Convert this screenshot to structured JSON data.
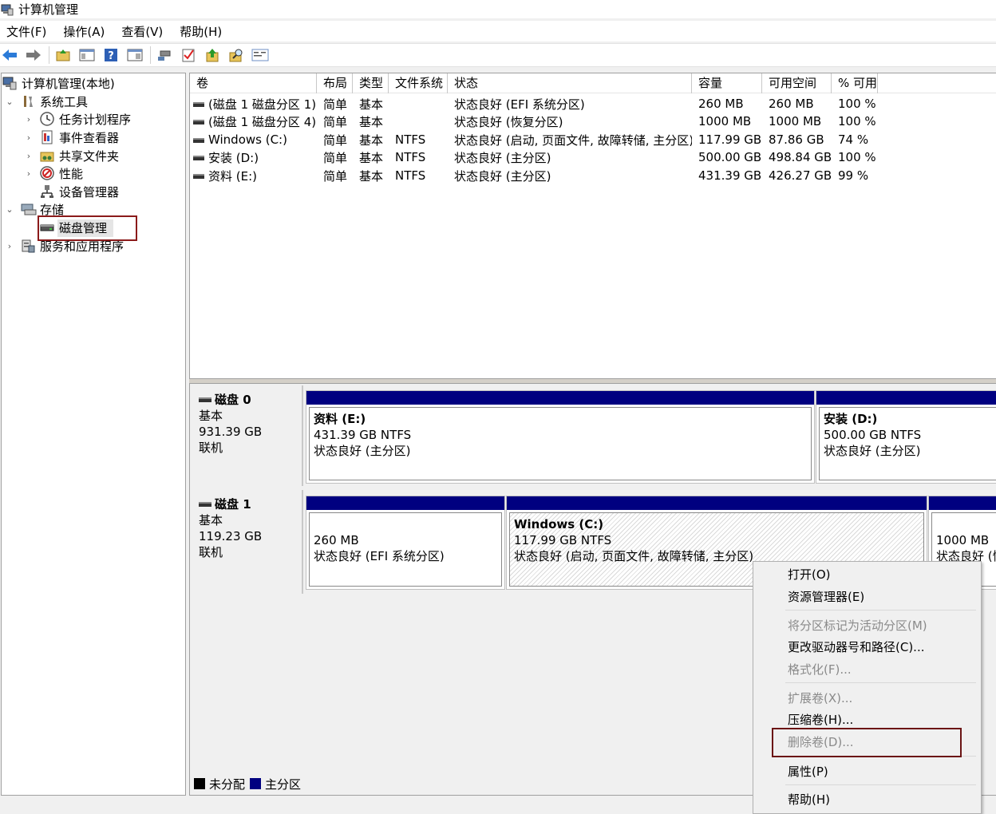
{
  "window": {
    "title": "计算机管理"
  },
  "menu": [
    "文件(F)",
    "操作(A)",
    "查看(V)",
    "帮助(H)"
  ],
  "toolbar": {
    "icons": [
      "back-arrow-icon",
      "forward-arrow-icon",
      "up-folder-icon",
      "show-hide-tree-icon",
      "help-icon",
      "console-icon",
      "connect-icon",
      "check-icon",
      "export-icon",
      "find-icon",
      "properties-icon"
    ]
  },
  "tree": {
    "root": "计算机管理(本地)",
    "system_tools": "系统工具",
    "task_scheduler": "任务计划程序",
    "event_viewer": "事件查看器",
    "shared_folders": "共享文件夹",
    "performance": "性能",
    "device_manager": "设备管理器",
    "storage": "存储",
    "disk_management": "磁盘管理",
    "services_apps": "服务和应用程序"
  },
  "volume_list": {
    "headers": [
      "卷",
      "布局",
      "类型",
      "文件系统",
      "状态",
      "容量",
      "可用空间",
      "% 可用"
    ],
    "rows": [
      {
        "vol": "(磁盘 1 磁盘分区 1)",
        "layout": "简单",
        "type": "基本",
        "fs": "",
        "status": "状态良好 (EFI 系统分区)",
        "cap": "260 MB",
        "free": "260 MB",
        "pct": "100 %"
      },
      {
        "vol": "(磁盘 1 磁盘分区 4)",
        "layout": "简单",
        "type": "基本",
        "fs": "",
        "status": "状态良好 (恢复分区)",
        "cap": "1000 MB",
        "free": "1000 MB",
        "pct": "100 %"
      },
      {
        "vol": "Windows (C:)",
        "layout": "简单",
        "type": "基本",
        "fs": "NTFS",
        "status": "状态良好 (启动, 页面文件, 故障转储, 主分区)",
        "cap": "117.99 GB",
        "free": "87.86 GB",
        "pct": "74 %"
      },
      {
        "vol": "安装 (D:)",
        "layout": "简单",
        "type": "基本",
        "fs": "NTFS",
        "status": "状态良好 (主分区)",
        "cap": "500.00 GB",
        "free": "498.84 GB",
        "pct": "100 %"
      },
      {
        "vol": "资料 (E:)",
        "layout": "简单",
        "type": "基本",
        "fs": "NTFS",
        "status": "状态良好 (主分区)",
        "cap": "431.39 GB",
        "free": "426.27 GB",
        "pct": "99 %"
      }
    ]
  },
  "disks": {
    "disk0": {
      "name": "磁盘 0",
      "kind": "基本",
      "size": "931.39 GB",
      "state": "联机",
      "p1": {
        "name": "资料  (E:)",
        "size": "431.39 GB NTFS",
        "status": "状态良好 (主分区)"
      },
      "p2": {
        "name": "安装  (D:)",
        "size": "500.00 GB NTFS",
        "status": "状态良好 (主分区)"
      }
    },
    "disk1": {
      "name": "磁盘 1",
      "kind": "基本",
      "size": "119.23 GB",
      "state": "联机",
      "p1": {
        "size": "260 MB",
        "status": "状态良好 (EFI 系统分区)"
      },
      "p2": {
        "name": "Windows  (C:)",
        "size": "117.99 GB NTFS",
        "status": "状态良好 (启动, 页面文件, 故障转储, 主分区)"
      },
      "p3": {
        "size": "1000 MB",
        "status": "状态良好 (恢"
      }
    }
  },
  "legend": {
    "unallocated": "未分配",
    "primary": "主分区",
    "unallocated_color": "#000000",
    "primary_color": "#000080"
  },
  "context_menu": {
    "open": "打开(O)",
    "explorer": "资源管理器(E)",
    "mark_active": "将分区标记为活动分区(M)",
    "change_letter": "更改驱动器号和路径(C)...",
    "format": "格式化(F)...",
    "extend": "扩展卷(X)...",
    "shrink": "压缩卷(H)...",
    "delete": "删除卷(D)...",
    "properties": "属性(P)",
    "help": "帮助(H)"
  }
}
